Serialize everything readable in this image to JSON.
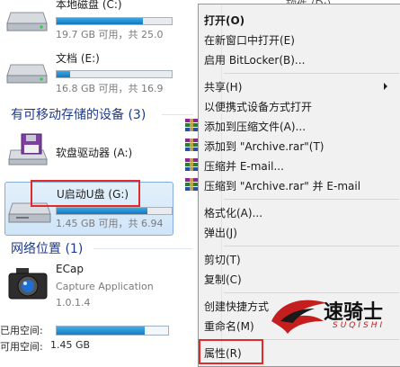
{
  "drives": [
    {
      "title": "本地磁盘 (C:)",
      "info": "19.7 GB 可用，共 25.0"
    },
    {
      "title": "文档 (E:)",
      "info": "16.8 GB 可用，共 16.9"
    }
  ],
  "bg_partial_text": "软件 (D:)",
  "sections": {
    "removable": "有可移动存储的设备 (3)",
    "network": "网络位置 (1)"
  },
  "removable_devices": [
    {
      "title": "软盘驱动器 (A:)"
    },
    {
      "title": "U启动U盘 (G:)",
      "info": "1.45 GB 可用，共 6.94",
      "fill_fraction": 0.79
    }
  ],
  "network_locations": [
    {
      "title": "ECap",
      "subtitle": "Capture Application",
      "version": "1.0.1.4"
    }
  ],
  "status_bar": {
    "used_label": "已用空间:",
    "free_label": "可用空间:",
    "free_value": "1.45 GB",
    "fill_fraction": 0.79
  },
  "context_menu": {
    "items": [
      {
        "label": "打开(O)",
        "bold": true
      },
      {
        "label": "在新窗口中打开(E)"
      },
      {
        "label": "启用 BitLocker(B)..."
      },
      {
        "label": "共享(H)",
        "submenu": true
      },
      {
        "label": "以便携式设备方式打开"
      },
      {
        "label": "添加到压缩文件(A)...",
        "icon": "winrar-icon"
      },
      {
        "label": "添加到 \"Archive.rar\"(T)",
        "icon": "winrar-icon"
      },
      {
        "label": "压缩并 E-mail...",
        "icon": "winrar-icon"
      },
      {
        "label": "压缩到 \"Archive.rar\" 并 E-mail",
        "icon": "winrar-icon"
      },
      {
        "label": "格式化(A)..."
      },
      {
        "label": "弹出(J)"
      },
      {
        "label": "剪切(T)"
      },
      {
        "label": "复制(C)"
      },
      {
        "label": "创建快捷方式"
      },
      {
        "label": "重命名(M)"
      },
      {
        "label": "属性(R)"
      }
    ]
  },
  "watermark": {
    "brand": "速骑士",
    "sub": "SUQISHI"
  },
  "colors": {
    "highlight_box": "#e22a2a",
    "selection_bg": "#cfe5f8",
    "bar_fill": "#1a7ac4",
    "section_text": "#1e3a8a"
  }
}
